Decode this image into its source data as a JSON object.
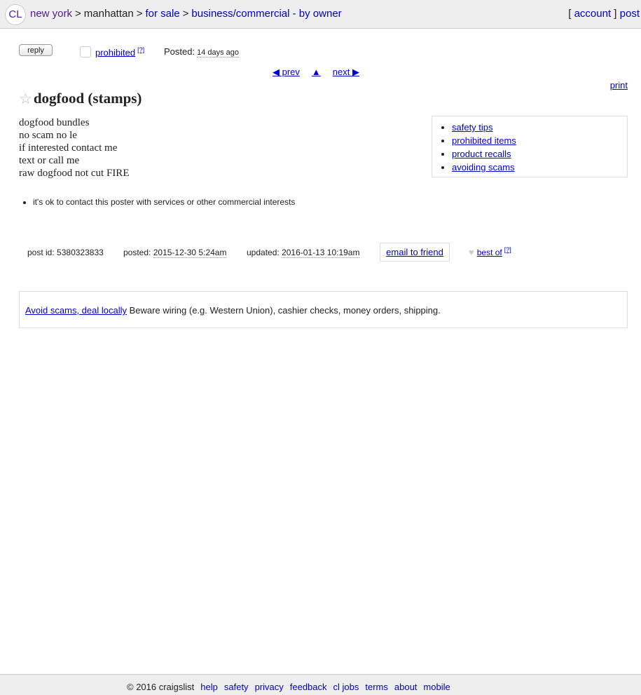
{
  "header": {
    "logo": "CL",
    "breadcrumbs": [
      "new york",
      "manhattan",
      "for sale",
      "business/commercial - by owner"
    ],
    "sep": ">",
    "account": "account",
    "post": "post"
  },
  "toolbar": {
    "reply": "reply",
    "prohibited": "prohibited",
    "help": "[?]",
    "posted_label": "Posted:",
    "posted_ago": "14 days ago"
  },
  "nav": {
    "prev": "◀ prev",
    "up": "▲",
    "next": "next ▶",
    "print": "print"
  },
  "posting": {
    "title": "dogfood (stamps)",
    "body_lines": [
      "dogfood bundles",
      "no scam no le",
      "if interested contact me",
      "text or call me",
      "raw dogfood not cut FIRE"
    ],
    "notice": "it's ok to contact this poster with services or other commercial interests"
  },
  "safety": [
    "safety tips",
    "prohibited items",
    "product recalls",
    "avoiding scams"
  ],
  "postinfo": {
    "post_id_label": "post id:",
    "post_id": "5380323833",
    "posted_label": "posted:",
    "posted": "2015-12-30 5:24am",
    "updated_label": "updated:",
    "updated": "2016-01-13 10:19am",
    "email_friend": "email to friend",
    "best_of": "best of",
    "help": "[?]"
  },
  "avoid": {
    "link": "Avoid scams, deal locally",
    "text": "Beware wiring (e.g. Western Union), cashier checks, money orders, shipping."
  },
  "footer": {
    "copyright": "© 2016 craigslist",
    "links": [
      "help",
      "safety",
      "privacy",
      "feedback",
      "cl jobs",
      "terms",
      "about",
      "mobile"
    ]
  }
}
